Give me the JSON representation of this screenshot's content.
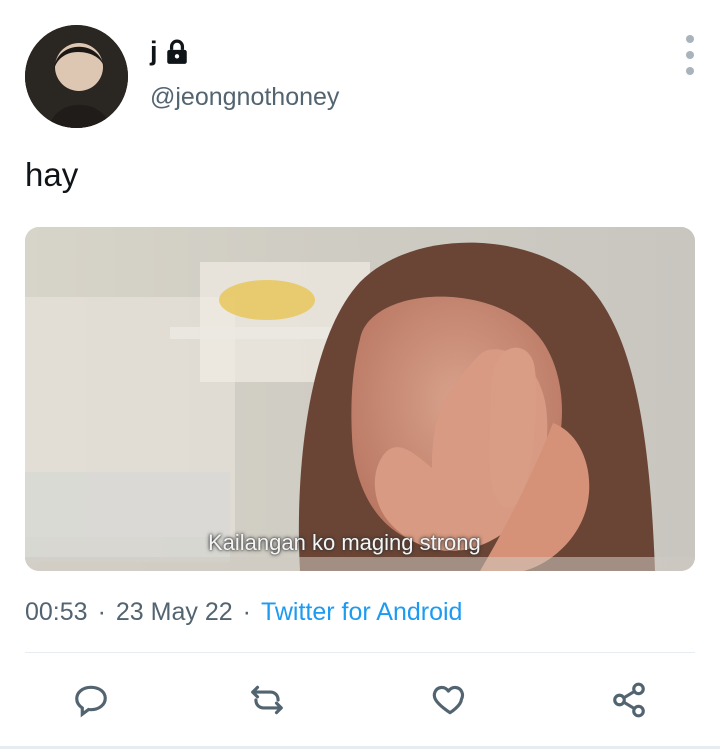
{
  "user": {
    "display_name": "j",
    "handle": "@jeongnothoney",
    "protected_icon": "lock-icon",
    "avatar_icon": "profile-avatar"
  },
  "tweet": {
    "text": "hay",
    "media_caption": "Kailangan ko maging strong",
    "time": "00:53",
    "date": "23 May 22",
    "source": "Twitter for Android",
    "separator": "·"
  },
  "actions": {
    "reply_icon": "reply-icon",
    "retweet_icon": "retweet-icon",
    "like_icon": "heart-icon",
    "share_icon": "share-icon"
  },
  "colors": {
    "text": "#0f1419",
    "muted": "#536471",
    "link": "#1d9bf0",
    "icon": "#536471"
  }
}
